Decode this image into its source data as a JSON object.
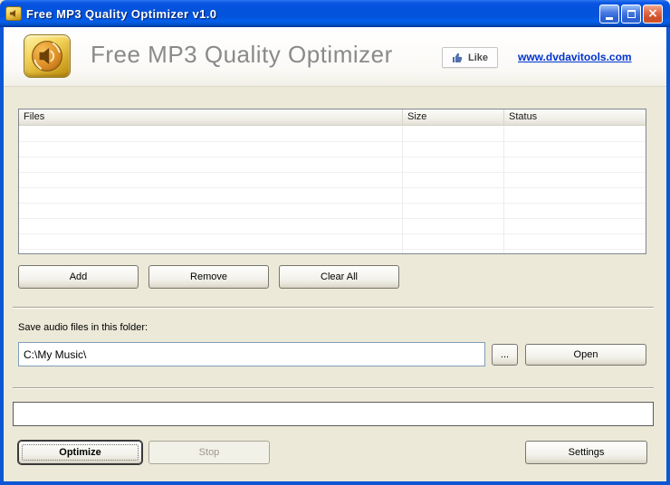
{
  "window": {
    "title": "Free MP3 Quality Optimizer v1.0"
  },
  "header": {
    "title": "Free MP3 Quality Optimizer",
    "like_button": "Like",
    "website_link": "www.dvdavitools.com"
  },
  "file_list": {
    "columns": [
      "Files",
      "Size",
      "Status"
    ],
    "rows": []
  },
  "list_actions": {
    "add": "Add",
    "remove": "Remove",
    "clear_all": "Clear All"
  },
  "output_folder": {
    "label": "Save audio files in this folder:",
    "path": "C:\\My Music\\",
    "browse": "...",
    "open": "Open"
  },
  "progress": {
    "value_percent": 0
  },
  "footer_actions": {
    "optimize": "Optimize",
    "stop": "Stop",
    "settings": "Settings"
  },
  "icons": {
    "app": "gold-speaker-icon",
    "like": "thumbs-up-icon"
  },
  "colors": {
    "titlebar_blue": "#0353DC",
    "window_bg": "#ECE9D8",
    "link_blue": "#0033CC",
    "logo_gold": "#E9C84F"
  }
}
